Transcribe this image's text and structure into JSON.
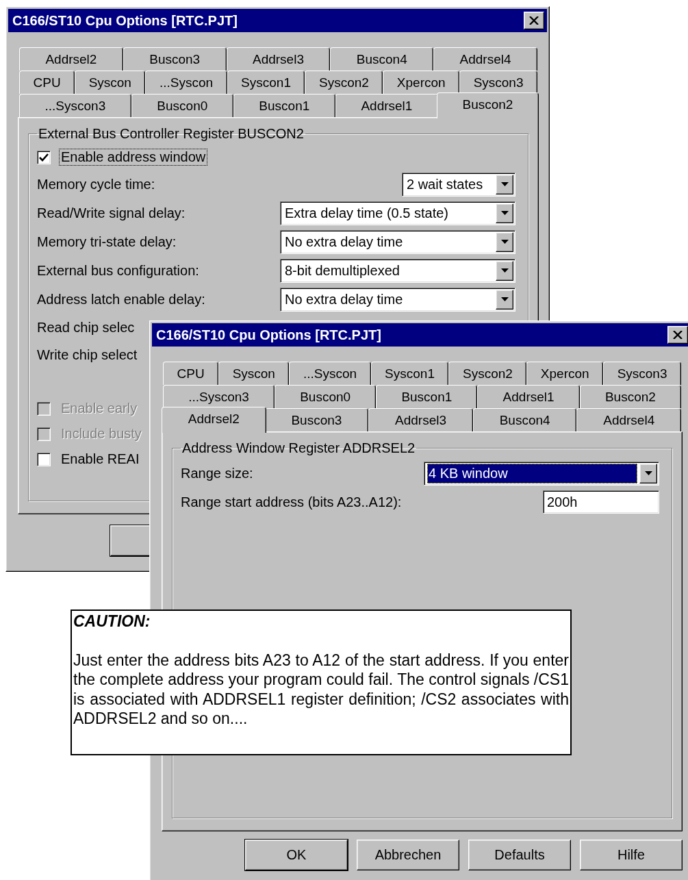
{
  "dialogs": [
    {
      "title": "C166/ST10 Cpu Options [RTC.PJT]",
      "tab_rows": [
        [
          {
            "label": "Addrsel2",
            "selected": false
          },
          {
            "label": "Buscon3",
            "selected": false
          },
          {
            "label": "Addrsel3",
            "selected": false
          },
          {
            "label": "Buscon4",
            "selected": false
          },
          {
            "label": "Addrsel4",
            "selected": false
          }
        ],
        [
          {
            "label": "CPU",
            "selected": false
          },
          {
            "label": "Syscon",
            "selected": false
          },
          {
            "label": "...Syscon",
            "selected": false
          },
          {
            "label": "Syscon1",
            "selected": false
          },
          {
            "label": "Syscon2",
            "selected": false
          },
          {
            "label": "Xpercon",
            "selected": false
          },
          {
            "label": "Syscon3",
            "selected": false
          }
        ],
        [
          {
            "label": "...Syscon3",
            "selected": false
          },
          {
            "label": "Buscon0",
            "selected": false
          },
          {
            "label": "Buscon1",
            "selected": false
          },
          {
            "label": "Addrsel1",
            "selected": false
          },
          {
            "label": "Buscon2",
            "selected": true
          }
        ]
      ],
      "group": {
        "title": "External Bus Controller Register BUSCON2",
        "items": [
          {
            "kind": "checkbox",
            "label": "Enable address window",
            "checked": true,
            "disabled": false,
            "focused": true
          },
          {
            "kind": "combo",
            "label": "Memory cycle time:",
            "value": "2 wait states",
            "narrow": true,
            "focused": false
          },
          {
            "kind": "combo",
            "label": "Read/Write signal delay:",
            "value": "Extra delay time (0.5 state)",
            "narrow": false,
            "focused": false
          },
          {
            "kind": "combo",
            "label": "Memory tri-state delay:",
            "value": "No extra delay time",
            "narrow": false,
            "focused": false
          },
          {
            "kind": "combo",
            "label": "External bus configuration:",
            "value": "8-bit demultiplexed",
            "narrow": false,
            "focused": false
          },
          {
            "kind": "combo",
            "label": "Address latch enable delay:",
            "value": "No extra delay time",
            "narrow": false,
            "focused": false
          },
          {
            "kind": "label",
            "label": "Read chip selec"
          },
          {
            "kind": "label",
            "label": "Write chip select"
          },
          {
            "kind": "spacer"
          },
          {
            "kind": "checkbox",
            "label": "Enable early",
            "checked": false,
            "disabled": true,
            "focused": false
          },
          {
            "kind": "checkbox",
            "label": "Include busty",
            "checked": false,
            "disabled": true,
            "focused": false
          },
          {
            "kind": "checkbox",
            "label": "Enable REAI",
            "checked": false,
            "disabled": false,
            "focused": false
          }
        ]
      },
      "buttons": [
        {
          "default": true
        }
      ]
    },
    {
      "title": "C166/ST10 Cpu Options [RTC.PJT]",
      "tab_rows": [
        [
          {
            "label": "CPU",
            "selected": false
          },
          {
            "label": "Syscon",
            "selected": false
          },
          {
            "label": "...Syscon",
            "selected": false
          },
          {
            "label": "Syscon1",
            "selected": false
          },
          {
            "label": "Syscon2",
            "selected": false
          },
          {
            "label": "Xpercon",
            "selected": false
          },
          {
            "label": "Syscon3",
            "selected": false
          }
        ],
        [
          {
            "label": "...Syscon3",
            "selected": false
          },
          {
            "label": "Buscon0",
            "selected": false
          },
          {
            "label": "Buscon1",
            "selected": false
          },
          {
            "label": "Addrsel1",
            "selected": false
          },
          {
            "label": "Buscon2",
            "selected": false
          }
        ],
        [
          {
            "label": "Addrsel2",
            "selected": true
          },
          {
            "label": "Buscon3",
            "selected": false
          },
          {
            "label": "Addrsel3",
            "selected": false
          },
          {
            "label": "Buscon4",
            "selected": false
          },
          {
            "label": "Addrsel4",
            "selected": false
          }
        ]
      ],
      "group": {
        "title": "Address Window Register ADDRSEL2",
        "items": [
          {
            "kind": "combo",
            "label": "Range size:",
            "value": "4 KB window",
            "narrow": false,
            "focused": true
          },
          {
            "kind": "text",
            "label": "Range start address (bits A23..A12):",
            "value": "200h"
          }
        ]
      },
      "buttons": [
        {
          "label": "OK",
          "default": true
        },
        {
          "label": "Abbrechen",
          "default": false
        },
        {
          "label": "Defaults",
          "default": false
        },
        {
          "label": "Hilfe",
          "default": false
        }
      ]
    }
  ],
  "caution": {
    "title": "CAUTION:",
    "text": "Just enter the address bits A23 to A12 of the start address. If you enter the complete address your program could fail. The control signals /CS1 is associated with ADDRSEL1 register definition; /CS2 associates with ADDRSEL2 and so on...."
  }
}
